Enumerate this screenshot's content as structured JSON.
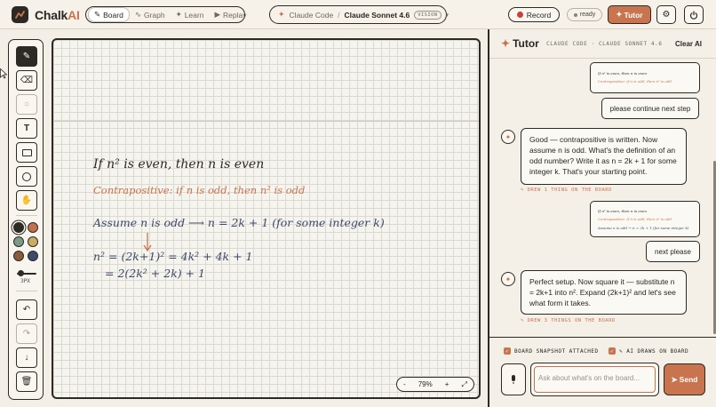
{
  "app": {
    "brand_main": "Chalk",
    "brand_accent": "AI"
  },
  "modes": [
    {
      "label": "Board",
      "icon": "✎",
      "active": true
    },
    {
      "label": "Graph",
      "icon": "∿",
      "active": false
    },
    {
      "label": "Learn",
      "icon": "✦",
      "active": false
    },
    {
      "label": "Replay",
      "icon": "▶",
      "active": false
    }
  ],
  "model": {
    "provider": "Claude Code",
    "separator": "/",
    "name": "Claude Sonnet 4.6",
    "badge": "VISION"
  },
  "header": {
    "record_label": "Record",
    "status_label": "ready",
    "tutor_label": "Tutor",
    "tutor_icon": "✦"
  },
  "toolbar": {
    "size_label": "3PX"
  },
  "colors": {
    "accent": "#c8744f",
    "ink_dark": "#2d2925",
    "ink_blue": "#3c4a6b",
    "swatches": [
      "#2d2925",
      "#c0714f",
      "#7c9a86",
      "#c9ad62",
      "#8b5a3c",
      "#3c4a6b"
    ]
  },
  "board": {
    "line1": "If n² is even, then n is even",
    "line2": "Contrapositive: if n is odd, then n² is odd",
    "line3": "Assume n is odd  ⟶  n = 2k + 1  (for some integer k)",
    "line4": "n² = (2k+1)² = 4k² + 4k + 1",
    "line5": "= 2(2k² + 2k) + 1",
    "zoom_minus": "-",
    "zoom_value": "79%",
    "zoom_plus": "+"
  },
  "panel": {
    "title": "Tutor",
    "subtitle": "CLAUDE CODE · CLAUDE SONNET 4.6",
    "clear_label": "Clear AI",
    "messages": {
      "thumb1_l1": "If n² is even, then n is even",
      "thumb1_l2": "Contrapositive: if n is odd, then n² is odd",
      "user1": "please continue next step",
      "ai1": "Good — contrapositive is written. Now assume n is odd. What's the definition of an odd number? Write it as n = 2k + 1 for some integer k. That's your starting point.",
      "ai1_note": "✎ DREW 1 THING ON THE BOARD",
      "thumb2_l1": "If n² is even, then n is even",
      "thumb2_l2": "Contrapositive: if n is odd, then n² is odd",
      "thumb2_l3": "Assume n is odd → n = 2k + 1 (for some integer k)",
      "user2": "next please",
      "ai2": "Perfect setup. Now square it — substitute n = 2k+1 into n². Expand (2k+1)² and let's see what form it takes.",
      "ai2_note": "✎ DREW 3 THINGS ON THE BOARD"
    },
    "footer": {
      "snapshot_label": "BOARD SNAPSHOT ATTACHED",
      "draws_label": "✎ AI DRAWS ON BOARD",
      "input_placeholder": "Ask about what's on the board...",
      "send_label": "Send"
    }
  }
}
